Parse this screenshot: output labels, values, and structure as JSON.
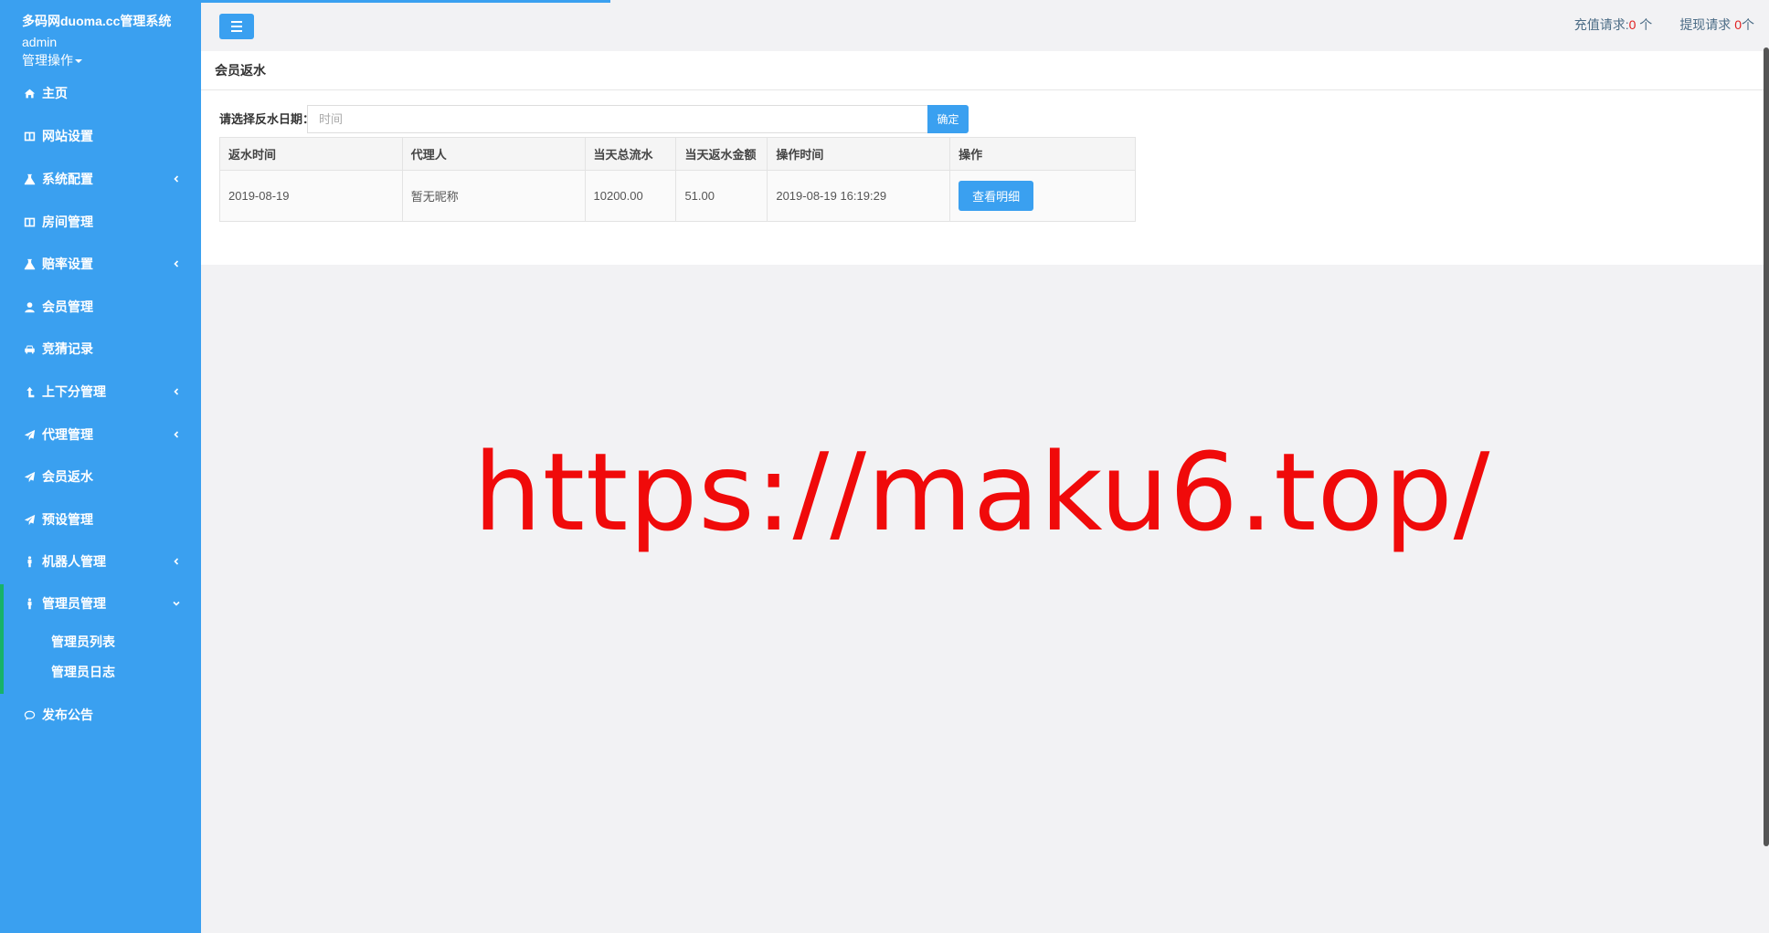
{
  "app": {
    "title": "多码网duoma.cc管理系统",
    "username": "admin",
    "user_menu": "管理操作"
  },
  "sidebar": {
    "items": [
      {
        "label": "主页",
        "icon": "home-icon",
        "has_arrow": false
      },
      {
        "label": "网站设置",
        "icon": "columns-icon",
        "has_arrow": false
      },
      {
        "label": "系统配置",
        "icon": "flask-icon",
        "has_arrow": true
      },
      {
        "label": "房间管理",
        "icon": "columns-icon",
        "has_arrow": false
      },
      {
        "label": "赔率设置",
        "icon": "flask-icon",
        "has_arrow": true
      },
      {
        "label": "会员管理",
        "icon": "user-icon",
        "has_arrow": false
      },
      {
        "label": "竞猜记录",
        "icon": "car-icon",
        "has_arrow": false
      },
      {
        "label": "上下分管理",
        "icon": "arrow-up-icon",
        "has_arrow": true
      },
      {
        "label": "代理管理",
        "icon": "paper-plane-icon",
        "has_arrow": true
      },
      {
        "label": "会员返水",
        "icon": "paper-plane-icon",
        "has_arrow": false
      },
      {
        "label": "预设管理",
        "icon": "paper-plane-icon",
        "has_arrow": false
      },
      {
        "label": "机器人管理",
        "icon": "male-icon",
        "has_arrow": true
      },
      {
        "label": "管理员管理",
        "icon": "male-icon",
        "has_arrow": true,
        "expanded": true
      },
      {
        "label": "发布公告",
        "icon": "comments-icon",
        "has_arrow": false
      }
    ],
    "sub_items": [
      "管理员列表",
      "管理员日志"
    ]
  },
  "topbar": {
    "recharge_label": "充值请求:",
    "recharge_count": "0",
    "recharge_unit": " 个",
    "withdraw_label": "提现请求 ",
    "withdraw_count": "0",
    "withdraw_unit": "个"
  },
  "main": {
    "title": "会员返水",
    "date_label": "请选择反水日期：",
    "date_placeholder": "时间",
    "confirm_label": "确定",
    "table": {
      "headers": [
        "返水时间",
        "代理人",
        "当天总流水",
        "当天返水金额",
        "操作时间",
        "操作"
      ],
      "rows": [
        {
          "date": "2019-08-19",
          "agent": "暂无昵称",
          "turnover": "10200.00",
          "rebate": "51.00",
          "op_time": "2019-08-19 16:19:29",
          "action": "查看明细"
        }
      ]
    }
  },
  "watermark": "https://maku6.top/",
  "colors": {
    "sidebar_bg": "#3aa0f0",
    "accent": "#3aa0f0",
    "count_red": "#e02020",
    "watermark_red": "#f00a0a",
    "active_bar": "#17b26a"
  }
}
